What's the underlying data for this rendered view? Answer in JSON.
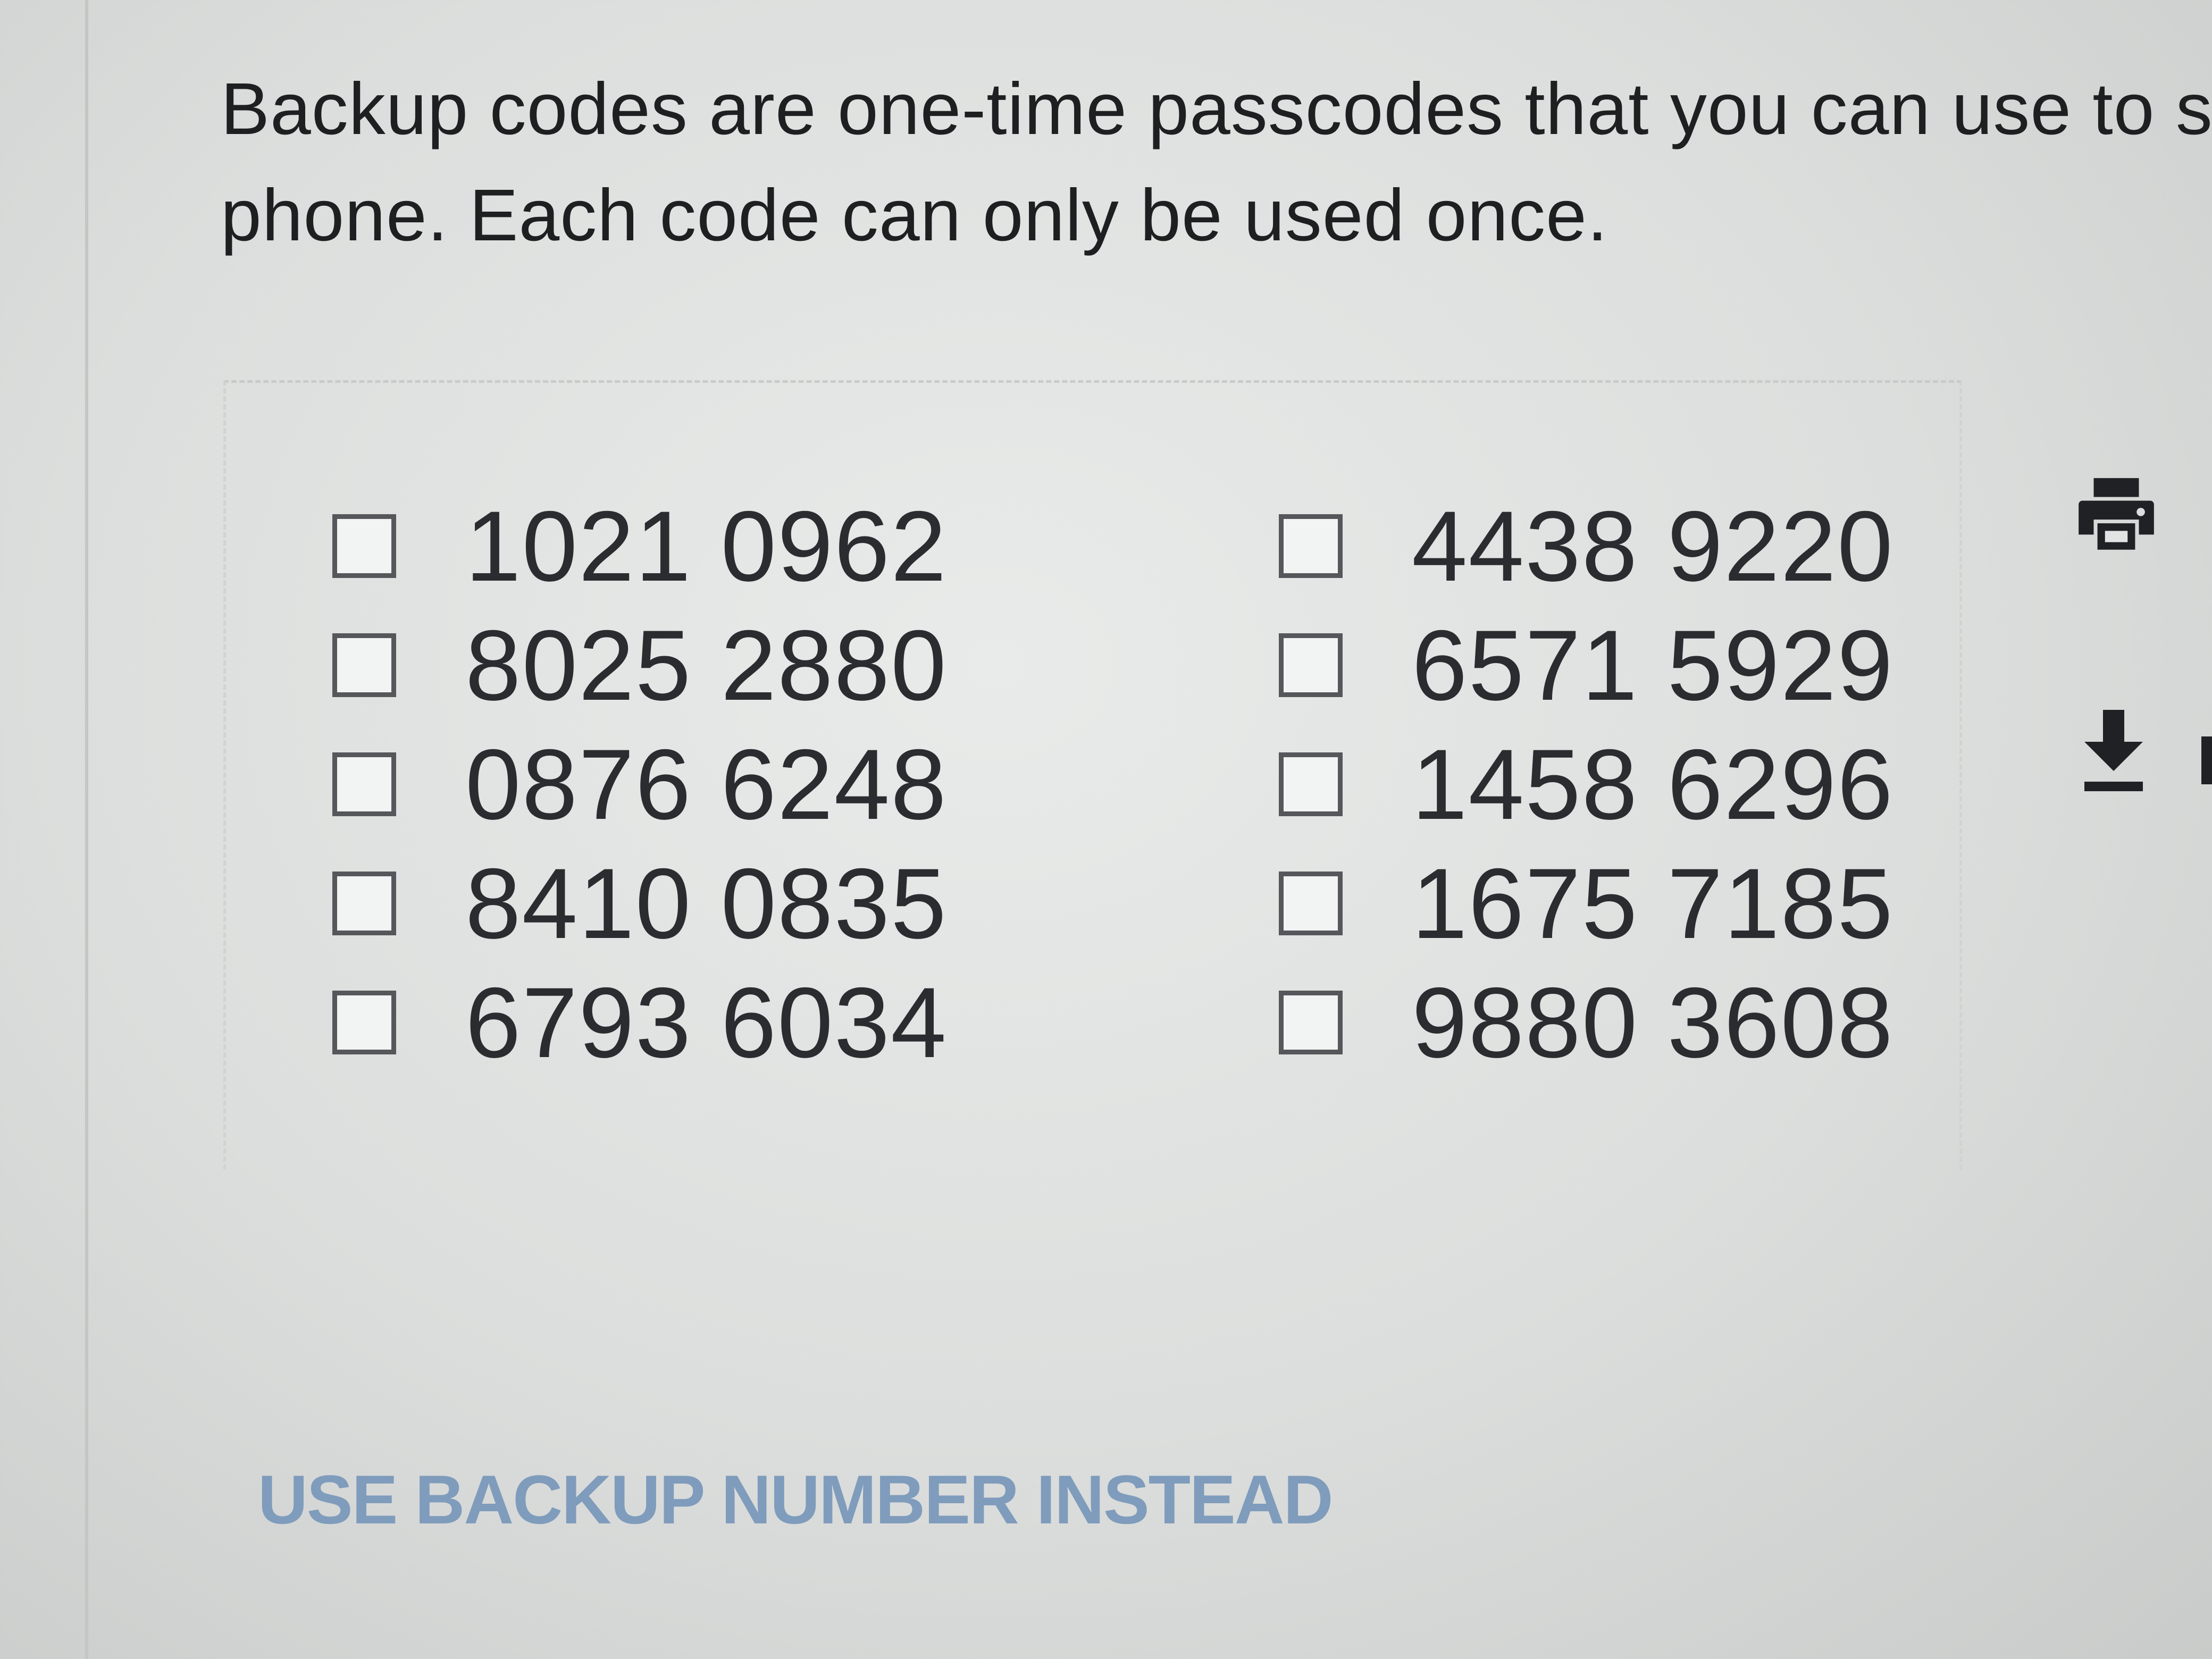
{
  "intro": {
    "line1": "Backup codes are one-time passcodes that you can use to sig",
    "line2": "phone. Each code can only be used once."
  },
  "codes": {
    "left": [
      "1021 0962",
      "8025 2880",
      "0876 6248",
      "8410 0835",
      "6793 6034"
    ],
    "right": [
      "4438 9220",
      "6571 5929",
      "1458 6296",
      "1675 7185",
      "9880 3608"
    ]
  },
  "actions": {
    "print_icon": "printer-icon",
    "download_icon": "download-icon"
  },
  "footer": {
    "link_label": "USE BACKUP NUMBER INSTEAD"
  },
  "colors": {
    "text": "#1d1f21",
    "code_text": "#2a2c30",
    "link": "#7f9cbc",
    "icon": "#1f2124"
  }
}
